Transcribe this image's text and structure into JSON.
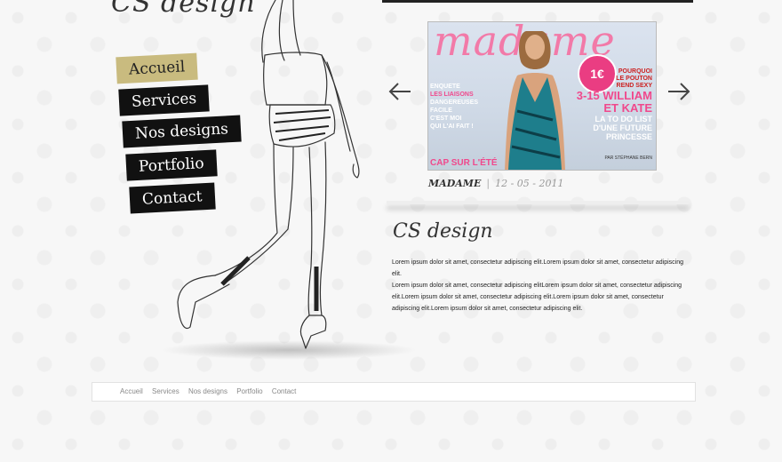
{
  "header": {
    "logo_top": "CS design"
  },
  "nav": {
    "items": [
      {
        "label": "Accueil",
        "active": true
      },
      {
        "label": "Services"
      },
      {
        "label": "Nos designs"
      },
      {
        "label": "Portfolio"
      },
      {
        "label": "Contact"
      }
    ],
    "active_color": "#c9bb7f",
    "item_color": "#111111"
  },
  "slider": {
    "magazine": {
      "title": "madame",
      "badge": "1€",
      "left_lines": [
        "ENQUETE",
        "LES LIAISONS",
        "DANGEREUSES",
        "FACILE",
        "C'EST MOI",
        "QUI L'AI FAIT !",
        "CAP SUR L'ÉTÉ"
      ],
      "right_lines": [
        "POURQUOI",
        "LE POUTON",
        "REND SEXY"
      ],
      "headline_big": "3-15 WILLIAM ET KATE",
      "headline_sub": "LA TO DO LIST D'UNE FUTURE PRINCESSE",
      "credit": "PAR STÉPHANE BERN",
      "accent": "#f27aa8"
    },
    "caption_name": "MADAME",
    "caption_date": "12 - 05 - 2011",
    "prev_icon": "arrow-left-icon",
    "next_icon": "arrow-right-icon"
  },
  "content": {
    "logo": "CS design",
    "paragraph1": "Lorem ipsum dolor sit amet, consectetur adipiscing elit.Lorem ipsum dolor sit amet, consectetur adipiscing elit.",
    "paragraph2": "Lorem ipsum dolor sit amet, consectetur adipiscing elitLorem ipsum dolor sit amet, consectetur adipiscing elit.Lorem ipsum dolor sit amet, consectetur adipiscing elit.Lorem ipsum dolor sit amet, consectetur adipiscing elit.Lorem ipsum dolor sit amet, consectetur adipiscing elit."
  },
  "footer": {
    "links": [
      "Accueil",
      "Services",
      "Nos designs",
      "Portfolio",
      "Contact"
    ]
  }
}
